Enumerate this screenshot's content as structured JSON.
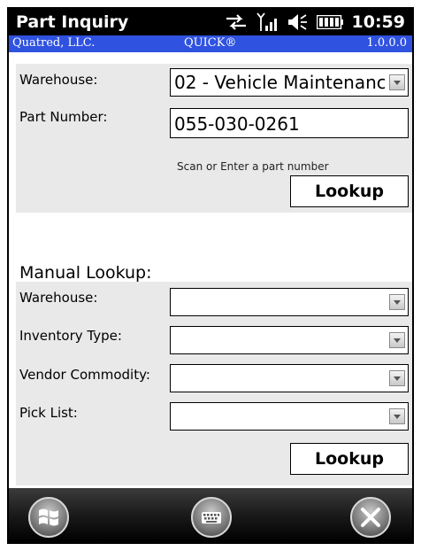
{
  "titlebar": {
    "title": "Part Inquiry",
    "time": "10:59"
  },
  "infobar": {
    "company": "Quatred, LLC.",
    "product": "QUICK®",
    "version": "1.0.0.0"
  },
  "quick": {
    "warehouse_label": "Warehouse:",
    "warehouse_value": "02 - Vehicle Maintenanc",
    "part_label": "Part Number:",
    "part_value": "055-030-0261",
    "hint": "Scan or Enter a part number",
    "lookup_label": "Lookup"
  },
  "manual": {
    "heading": "Manual Lookup:",
    "warehouse_label": "Warehouse:",
    "inventory_label": "Inventory Type:",
    "vendor_label": "Vendor Commodity:",
    "picklist_label": "Pick List:",
    "lookup_label": "Lookup"
  },
  "icons": [
    "sync-icon",
    "signal-icon",
    "volume-icon",
    "battery-icon",
    "windows-start-icon",
    "keyboard-icon",
    "close-icon"
  ],
  "colors": {
    "infobar": "#2f52e0",
    "panel": "#e9e9e9"
  }
}
